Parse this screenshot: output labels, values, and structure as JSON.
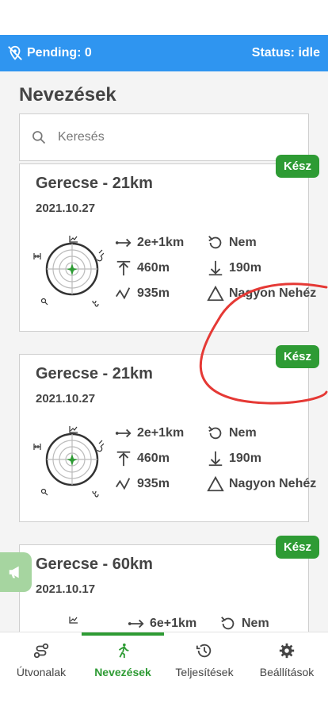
{
  "status_bar": {
    "pending": "Pending: 0",
    "status": "Status: idle"
  },
  "page": {
    "title": "Nevezések"
  },
  "search": {
    "placeholder": "Keresés"
  },
  "cards": [
    {
      "badge": "Kész",
      "name": "Gerecse - 21km",
      "date": "2021.10.27",
      "distance": "2e+1km",
      "ascent": "460m",
      "elevation": "935m",
      "loop": "Nem",
      "descent": "190m",
      "difficulty": "Nagyon Nehéz"
    },
    {
      "badge": "Kész",
      "name": "Gerecse - 21km",
      "date": "2021.10.27",
      "distance": "2e+1km",
      "ascent": "460m",
      "elevation": "935m",
      "loop": "Nem",
      "descent": "190m",
      "difficulty": "Nagyon Nehéz"
    },
    {
      "badge": "Kész",
      "name": "Gerecse - 60km",
      "date": "2021.10.17",
      "distance": "6e+1km",
      "loop": "Nem"
    }
  ],
  "nav": {
    "items": [
      {
        "label": "Útvonalak",
        "icon": "route-icon"
      },
      {
        "label": "Nevezések",
        "icon": "runner-icon"
      },
      {
        "label": "Teljesítések",
        "icon": "history-icon"
      },
      {
        "label": "Beállítások",
        "icon": "gear-icon"
      }
    ],
    "active": "Nevezések"
  },
  "colors": {
    "primary": "#2f95f0",
    "accent": "#2e9b34",
    "annotation": "#e53935"
  }
}
